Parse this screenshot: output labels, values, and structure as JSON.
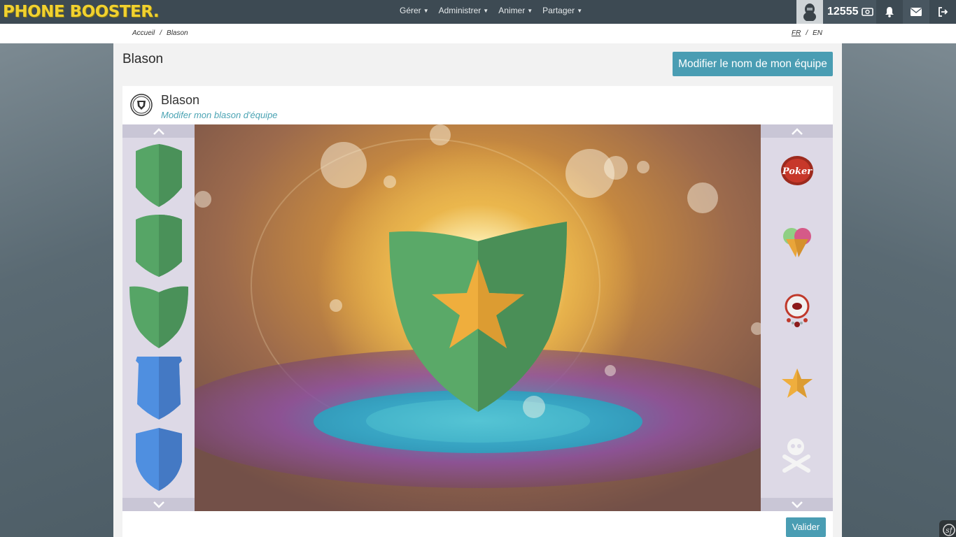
{
  "app": {
    "logo_text": "PHONE BOOSTER."
  },
  "nav": {
    "menu": [
      {
        "label": "Gérer"
      },
      {
        "label": "Administrer"
      },
      {
        "label": "Animer"
      },
      {
        "label": "Partager"
      }
    ],
    "credits": "12555",
    "icons": [
      "user-avatar-icon",
      "money-icon",
      "bell-icon",
      "envelope-icon",
      "logout-icon"
    ]
  },
  "breadcrumb": {
    "home": "Accueil",
    "current": "Blason",
    "separator": "/"
  },
  "langs": {
    "fr": "FR",
    "en": "EN",
    "separator": "/"
  },
  "page": {
    "title": "Blason",
    "rename_button": "Modifier le nom de mon équipe"
  },
  "card": {
    "title": "Blason",
    "subtitle": "Modifer mon blason d'équipe",
    "validate_button": "Valider"
  },
  "editor": {
    "left_options": [
      {
        "icon": "green-shield-1-icon",
        "color": "#4f9e5f"
      },
      {
        "icon": "green-shield-2-icon",
        "color": "#4f9e5f"
      },
      {
        "icon": "green-shield-3-icon",
        "color": "#4f9e5f"
      },
      {
        "icon": "blue-shield-1-icon",
        "color": "#4a86d8"
      },
      {
        "icon": "blue-shield-2-icon",
        "color": "#4a86d8"
      }
    ],
    "right_options": [
      {
        "icon": "poker-emblem-icon",
        "logo_text": "Poker"
      },
      {
        "icon": "ice-cream-icon"
      },
      {
        "icon": "robot-eye-icon"
      },
      {
        "icon": "star-icon",
        "color": "#e9a53a"
      },
      {
        "icon": "skull-crossbones-icon"
      }
    ],
    "selected_shield_color": "#4f9e5f",
    "selected_emblem_color": "#e9a53a"
  },
  "colors": {
    "accent": "#4a9db3",
    "navbar": "#3d4a53",
    "logo": "#f1d12f"
  }
}
